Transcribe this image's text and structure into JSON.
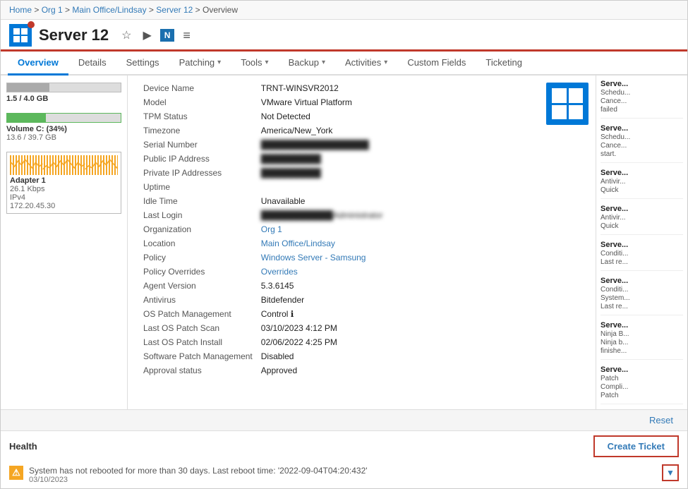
{
  "breadcrumb": {
    "items": [
      "Home",
      "Org 1",
      "Main Office/Lindsay",
      "Server 12",
      "Overview"
    ]
  },
  "header": {
    "title": "Server 12",
    "star_label": "☆",
    "play_label": "▶",
    "shield_label": "N",
    "menu_label": "≡"
  },
  "tabs": [
    {
      "label": "Overview",
      "active": true
    },
    {
      "label": "Details",
      "active": false
    },
    {
      "label": "Settings",
      "active": false
    },
    {
      "label": "Patching",
      "active": false,
      "hasChevron": true
    },
    {
      "label": "Tools",
      "active": false,
      "hasChevron": true
    },
    {
      "label": "Backup",
      "active": false,
      "hasChevron": true
    },
    {
      "label": "Activities",
      "active": false,
      "hasChevron": true
    },
    {
      "label": "Custom Fields",
      "active": false
    },
    {
      "label": "Ticketing",
      "active": false
    }
  ],
  "left_panel": {
    "resources": [
      {
        "label": "1.5 / 4.0 GB",
        "fill_pct": 37,
        "type": "gray"
      },
      {
        "label": "Volume C: (34%)",
        "sub": "13.6 / 39.7 GB",
        "fill_pct": 34,
        "type": "green"
      }
    ],
    "adapter": {
      "title": "Adapter 1",
      "speed": "26.1 Kbps",
      "type": "IPv4",
      "ip": "172.20.45.30"
    }
  },
  "device_info": {
    "fields": [
      {
        "label": "Device Name",
        "value": "TRNT-WINSVR2012",
        "blurred": false
      },
      {
        "label": "Model",
        "value": "VMware Virtual Platform",
        "blurred": false
      },
      {
        "label": "TPM Status",
        "value": "Not Detected",
        "blurred": false
      },
      {
        "label": "Timezone",
        "value": "America/New_York",
        "blurred": false
      },
      {
        "label": "Serial Number",
        "value": "██████████████████",
        "blurred": true
      },
      {
        "label": "Public IP Address",
        "value": "██████████",
        "blurred": true
      },
      {
        "label": "Private IP Addresses",
        "value": "██████████",
        "blurred": true
      },
      {
        "label": "Uptime",
        "value": "",
        "blurred": false
      },
      {
        "label": "Idle Time",
        "value": "Unavailable",
        "blurred": false
      },
      {
        "label": "Last Login",
        "value": "████████████Administrator",
        "blurred": true
      },
      {
        "label": "Organization",
        "value": "Org 1",
        "link": true,
        "blurred": false
      },
      {
        "label": "Location",
        "value": "Main Office/Lindsay",
        "link": true,
        "blurred": false
      },
      {
        "label": "Policy",
        "value": "Windows Server - Samsung",
        "link": true,
        "blurred": false
      },
      {
        "label": "Policy Overrides",
        "value": "Overrides",
        "link": true,
        "blurred": false
      },
      {
        "label": "Agent Version",
        "value": "5.3.6145",
        "blurred": false
      },
      {
        "label": "Antivirus",
        "value": "Bitdefender",
        "blurred": false
      },
      {
        "label": "OS Patch Management",
        "value": "Control ℹ",
        "blurred": false
      },
      {
        "label": "Last OS Patch Scan",
        "value": "03/10/2023 4:12 PM",
        "blurred": false
      },
      {
        "label": "Last OS Patch Install",
        "value": "02/06/2022 4:25 PM",
        "blurred": false
      },
      {
        "label": "Software Patch Management",
        "value": "Disabled",
        "blurred": false
      },
      {
        "label": "Approval status",
        "value": "Approved",
        "blurred": false
      }
    ]
  },
  "right_panel": {
    "activities": [
      {
        "title": "Serve...",
        "detail": "Schedu...\nCance...\nfailed"
      },
      {
        "title": "Serve...",
        "detail": "Schedu...\nCance...\nstart."
      },
      {
        "title": "Serve...",
        "detail": "Antivir...\nQuick"
      },
      {
        "title": "Serve...",
        "detail": "Antivir...\nQuick"
      },
      {
        "title": "Serve...",
        "detail": "Conditi...\nLast re..."
      },
      {
        "title": "Serve...",
        "detail": "Conditi...\nSystem...\nLast re..."
      },
      {
        "title": "Serve...",
        "detail": "Ninja B...\nNinja b...\nfinishe..."
      },
      {
        "title": "Serve...",
        "detail": "Patch\nCompli...\nPatch"
      }
    ]
  },
  "bottom": {
    "reset_label": "Reset",
    "health_title": "Health",
    "create_ticket_label": "Create Ticket",
    "alert_text": "System has not rebooted for more than 30 days. Last reboot time: '2022-09-04T04:20:432'",
    "alert_date": "03/10/2023",
    "dropdown_arrow": "▼"
  }
}
